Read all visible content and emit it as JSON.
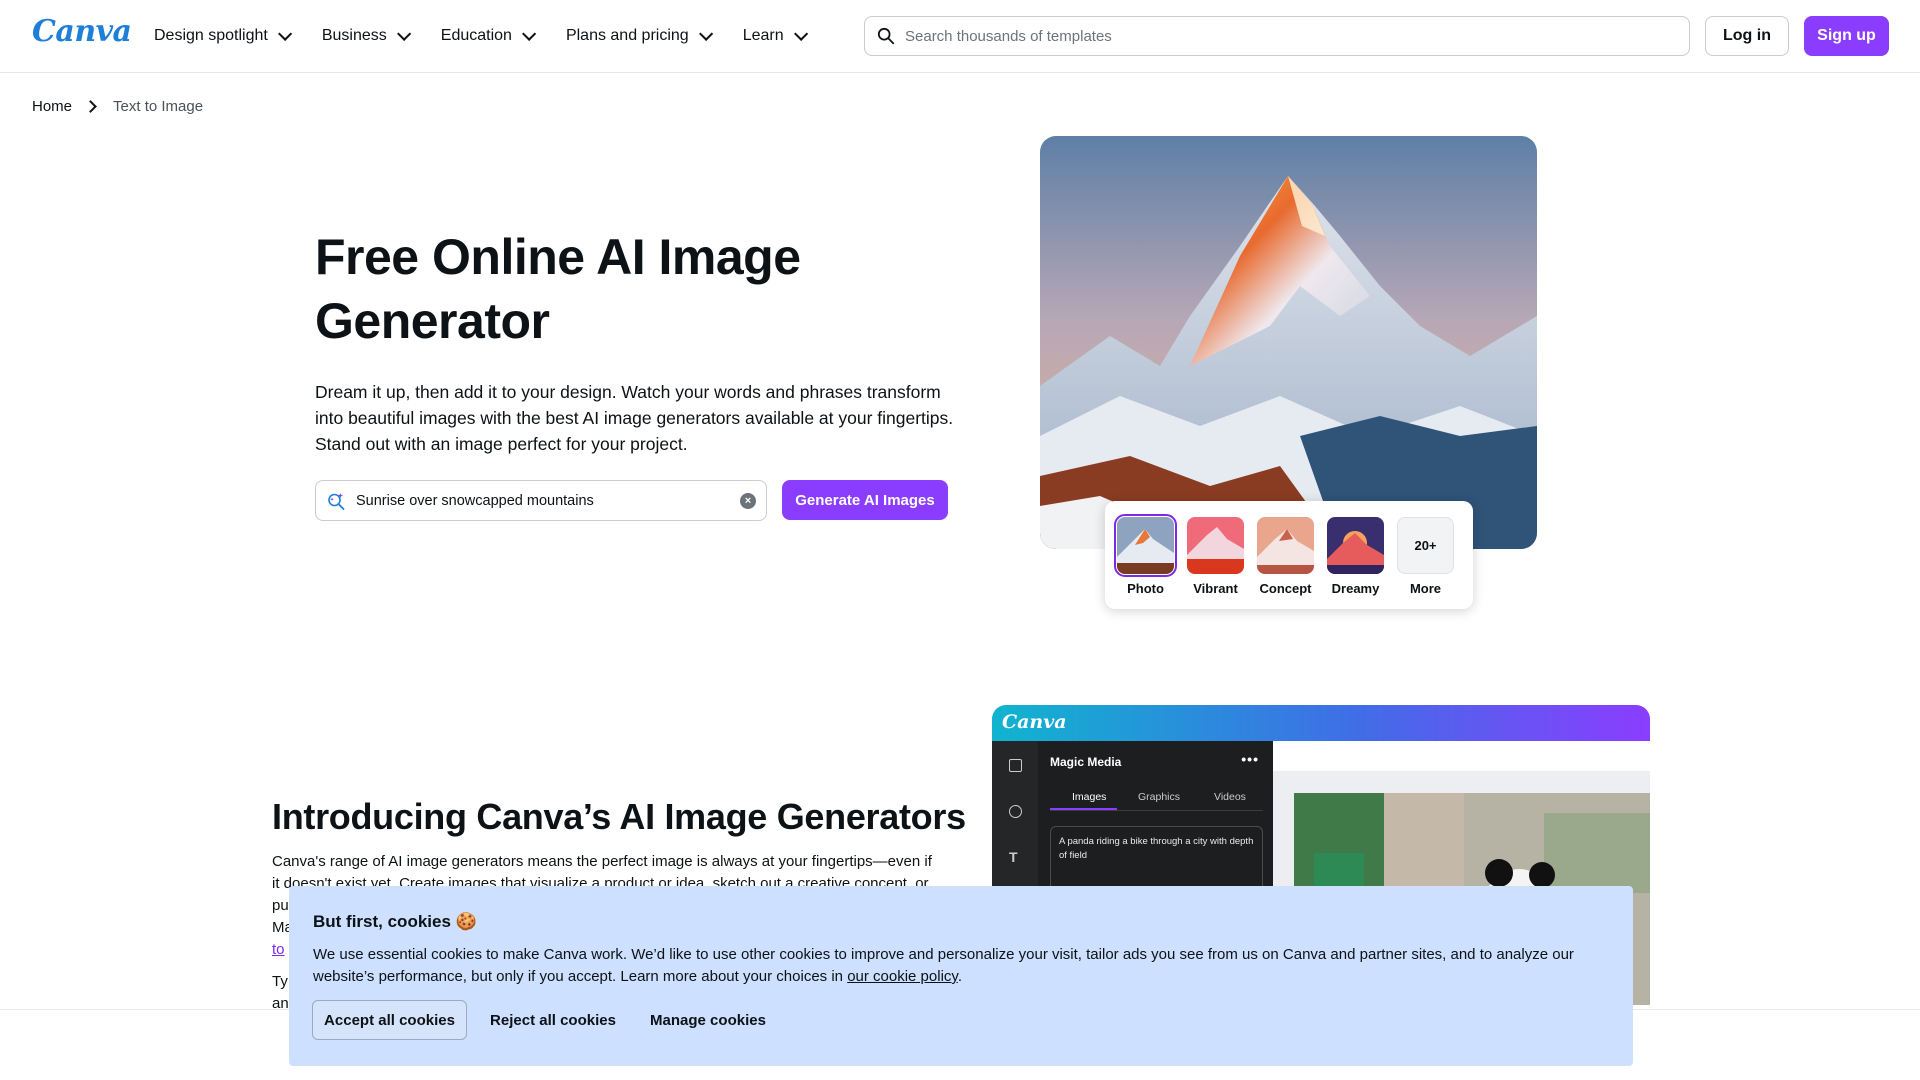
{
  "header": {
    "logo": "Canva",
    "nav": [
      {
        "label": "Design spotlight"
      },
      {
        "label": "Business"
      },
      {
        "label": "Education"
      },
      {
        "label": "Plans and pricing"
      },
      {
        "label": "Learn"
      }
    ],
    "search_placeholder": "Search thousands of templates",
    "login_label": "Log in",
    "signup_label": "Sign up"
  },
  "breadcrumb": {
    "home": "Home",
    "current": "Text to Image"
  },
  "hero": {
    "title": "Free Online AI Image Generator",
    "description": "Dream it up, then add it to your design. Watch your words and phrases transform into beautiful images with the best AI image generators available at your fingertips. Stand out with an image perfect for your project.",
    "prompt_value": "Sunrise over snowcapped mountains",
    "generate_label": "Generate AI Images",
    "styles": [
      {
        "label": "Photo",
        "selected": true
      },
      {
        "label": "Vibrant",
        "selected": false
      },
      {
        "label": "Concept",
        "selected": false
      },
      {
        "label": "Dreamy",
        "selected": false
      }
    ],
    "more_count": "20+",
    "more_label": "More"
  },
  "intro": {
    "title": "Introducing Canva’s AI Image Generators",
    "paragraph": "Canva's range of AI image generators means the perfect image is always at your fingertips—even if it doesn't exist yet. Create images that visualize a product or idea, sketch out a creative concept, or pu",
    "paragraph_tail": "Ma",
    "link_fragment": "to",
    "paragraph2_start": "Ty",
    "paragraph2_line2": "an"
  },
  "mockup": {
    "logo": "Canva",
    "panel_title": "Magic Media",
    "tabs": [
      "Images",
      "Graphics",
      "Videos"
    ],
    "prompt_text": "A panda riding a bike through a city with depth of field"
  },
  "cookie": {
    "title": "But first, cookies 🍪",
    "text_before_link": "We use essential cookies to make Canva work. We’d like to use other cookies to improve and personalize your visit, tailor ads you see from us on Canva and partner sites, and to analyze our website’s performance, but only if you accept. Learn more about your choices in ",
    "link_label": "our cookie policy",
    "text_after_link": ".",
    "accept_label": "Accept all cookies",
    "reject_label": "Reject all cookies",
    "manage_label": "Manage cookies"
  },
  "colors": {
    "brand_purple": "#8b3dff",
    "cookie_bg": "#cde0ff",
    "logo_blue": "#1e7fd9"
  }
}
